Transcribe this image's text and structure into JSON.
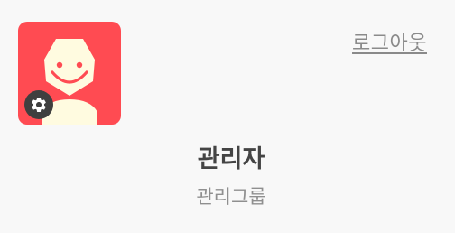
{
  "profile": {
    "avatar": {
      "icon": "smiley-avatar-icon",
      "background_color": "#ff4b52",
      "face_color": "#fffbe0"
    },
    "settings_icon": "gear-icon",
    "name": "관리자",
    "group": "관리그룹"
  },
  "header": {
    "logout_label": "로그아웃"
  }
}
